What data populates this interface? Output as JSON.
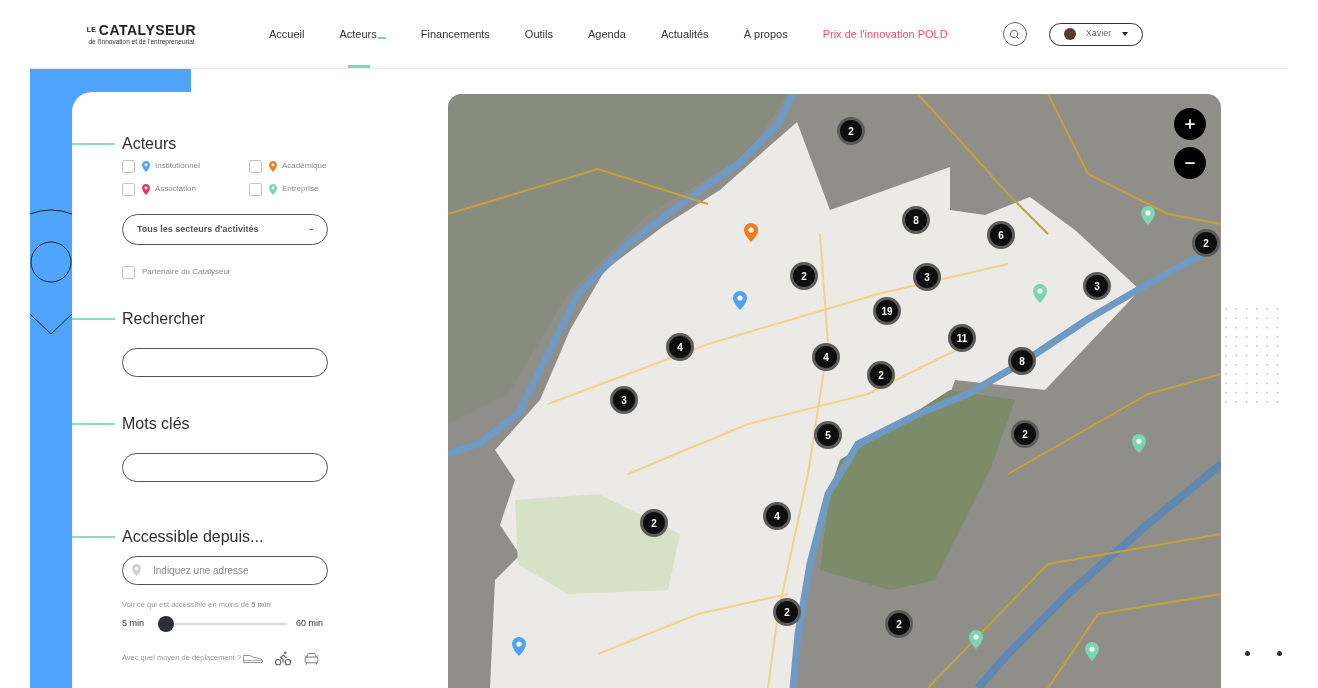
{
  "header": {
    "logo": {
      "prefix": "LE",
      "name": "CATALYSEUR",
      "tagline": "de l'innovation et de l'entrepreneuriat"
    },
    "nav": [
      {
        "label": "Accueil",
        "selected": false,
        "submenu": false,
        "kind": "link"
      },
      {
        "label": "Acteurs",
        "selected": true,
        "submenu": true,
        "kind": "link"
      },
      {
        "label": "Financements",
        "selected": false,
        "submenu": false,
        "kind": "link"
      },
      {
        "label": "Outils",
        "selected": false,
        "submenu": false,
        "kind": "link"
      },
      {
        "label": "Agenda",
        "selected": false,
        "submenu": false,
        "kind": "link"
      },
      {
        "label": "Actualités",
        "selected": false,
        "submenu": false,
        "kind": "link"
      },
      {
        "label": "À propos",
        "selected": false,
        "submenu": false,
        "kind": "link"
      },
      {
        "label": "Prix de l'innovation POLD",
        "selected": false,
        "submenu": false,
        "kind": "promo"
      }
    ],
    "user": {
      "name": "Xavier"
    }
  },
  "filters": {
    "actors": {
      "title": "Acteurs",
      "types": [
        {
          "label": "Institutionnel",
          "checked": false,
          "color": "#4ea3f5"
        },
        {
          "label": "Académique",
          "checked": false,
          "color": "#f07c1b"
        },
        {
          "label": "Association",
          "checked": false,
          "color": "#e5336d"
        },
        {
          "label": "Entreprise",
          "checked": false,
          "color": "#7ad6ad"
        }
      ],
      "sector_select": {
        "value": "Tous les secteurs d'activités"
      },
      "partner": {
        "label": "Partenaire du Catalyseur",
        "checked": false
      }
    },
    "search": {
      "title": "Rechercher"
    },
    "keywords": {
      "title": "Mots clés"
    },
    "accessibility": {
      "title": "Accessible depuis...",
      "address": {
        "placeholder": "Indiquez une adresse"
      },
      "hint": "Voir ce qui est accessible en moins de **5 min**",
      "slider": {
        "min_label": "5 min",
        "max_label": "60 min",
        "level": 0
      },
      "transport_label": "Avec quel moyen de déplacement ?"
    }
  },
  "map": {
    "clusters": [
      {
        "count": "2"
      },
      {
        "count": "8"
      },
      {
        "count": "6"
      },
      {
        "count": "2"
      },
      {
        "count": "2"
      },
      {
        "count": "3"
      },
      {
        "count": "3"
      },
      {
        "count": "19"
      },
      {
        "count": "11"
      },
      {
        "count": "4"
      },
      {
        "count": "4"
      },
      {
        "count": "8"
      },
      {
        "count": "2"
      },
      {
        "count": "3"
      },
      {
        "count": "2"
      },
      {
        "count": "5"
      },
      {
        "count": "4"
      },
      {
        "count": "2"
      },
      {
        "count": "2"
      },
      {
        "count": "2"
      }
    ],
    "pins": [
      {
        "color": "#7ad6ad"
      },
      {
        "color": "#f07c1b"
      },
      {
        "color": "#7ad6ad"
      },
      {
        "color": "#4ea3f5"
      },
      {
        "color": "#7ad6ad"
      },
      {
        "color": "#7ad6ad"
      },
      {
        "color": "#7ad6ad"
      },
      {
        "color": "#4ea3f5"
      }
    ]
  }
}
